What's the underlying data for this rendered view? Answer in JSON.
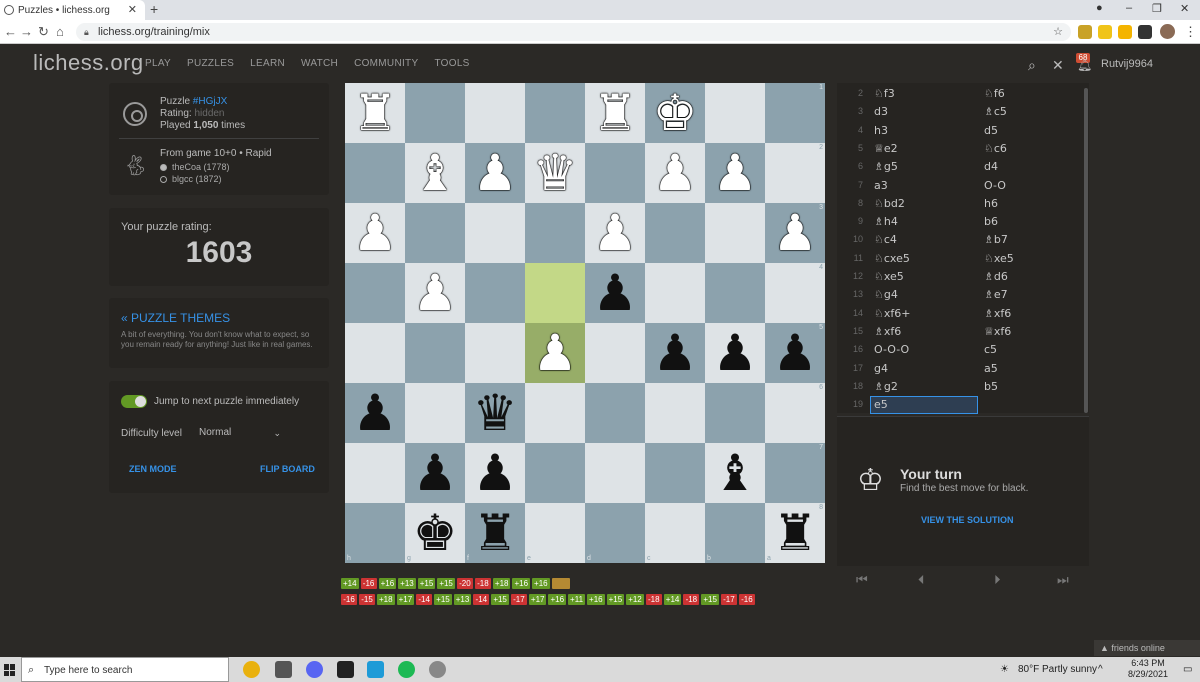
{
  "browser": {
    "tab_title": "Puzzles • lichess.org",
    "url": "lichess.org/training/mix"
  },
  "header": {
    "logo": "lichess.org",
    "nav": [
      "PLAY",
      "PUZZLES",
      "LEARN",
      "WATCH",
      "COMMUNITY",
      "TOOLS"
    ],
    "notification_count": "68",
    "username": "Rutvij9964"
  },
  "puzzle_info": {
    "puzzle_label": "Puzzle",
    "puzzle_id": "#HGjJX",
    "rating_label": "Rating:",
    "rating_value": "hidden",
    "played_prefix": "Played",
    "played_count": "1,050",
    "played_suffix": "times",
    "game_label": "From game 10+0 • Rapid",
    "white_player": "theCoa (1778)",
    "black_player": "blgcc (1872)"
  },
  "user_rating": {
    "label": "Your puzzle rating:",
    "value": "1603"
  },
  "themes": {
    "title": "« PUZZLE THEMES",
    "description": "A bit of everything. You don't know what to expect, so you remain ready for anything! Just like in real games."
  },
  "settings": {
    "jump_label": "Jump to next puzzle immediately",
    "jump_enabled": true,
    "difficulty_label": "Difficulty level",
    "difficulty_value": "Normal",
    "zen_mode": "ZEN MODE",
    "flip_board": "FLIP BOARD"
  },
  "board": {
    "orientation": "black",
    "rows": [
      [
        "wR",
        "",
        "",
        "",
        "wR",
        "wK",
        "",
        ""
      ],
      [
        "",
        "wB",
        "wP",
        "wQ",
        "",
        "wP",
        "wP",
        ""
      ],
      [
        "wP",
        "",
        "",
        "",
        "wP",
        "",
        "",
        "wP"
      ],
      [
        "",
        "wP",
        "",
        "HL",
        "bP",
        "",
        "",
        ""
      ],
      [
        "",
        "",
        "",
        "wP*",
        "",
        "bP",
        "bP",
        "bP"
      ],
      [
        "bP",
        "",
        "bQ",
        "",
        "",
        "",
        "",
        ""
      ],
      [
        "",
        "bP",
        "bP",
        "",
        "",
        "",
        "bB",
        ""
      ],
      [
        "",
        "bK",
        "bR",
        "",
        "",
        "",
        "",
        "bR"
      ]
    ],
    "rank_labels": [
      "1",
      "2",
      "3",
      "4",
      "5",
      "6",
      "7",
      "8"
    ],
    "file_labels": [
      "h",
      "g",
      "f",
      "e",
      "d",
      "c",
      "b",
      "a"
    ]
  },
  "moves": [
    {
      "n": "2",
      "w": "♘f3",
      "b": "♘f6"
    },
    {
      "n": "3",
      "w": "d3",
      "b": "♗c5"
    },
    {
      "n": "4",
      "w": "h3",
      "b": "d5"
    },
    {
      "n": "5",
      "w": "♕e2",
      "b": "♘c6"
    },
    {
      "n": "6",
      "w": "♗g5",
      "b": "d4"
    },
    {
      "n": "7",
      "w": "a3",
      "b": "O-O"
    },
    {
      "n": "8",
      "w": "♘bd2",
      "b": "h6"
    },
    {
      "n": "9",
      "w": "♗h4",
      "b": "b6"
    },
    {
      "n": "10",
      "w": "♘c4",
      "b": "♗b7"
    },
    {
      "n": "11",
      "w": "♘cxe5",
      "b": "♘xe5"
    },
    {
      "n": "12",
      "w": "♘xe5",
      "b": "♗d6"
    },
    {
      "n": "13",
      "w": "♘g4",
      "b": "♗e7"
    },
    {
      "n": "14",
      "w": "♘xf6+",
      "b": "♗xf6"
    },
    {
      "n": "15",
      "w": "♗xf6",
      "b": "♕xf6"
    },
    {
      "n": "16",
      "w": "O-O-O",
      "b": "c5"
    },
    {
      "n": "17",
      "w": "g4",
      "b": "a5"
    },
    {
      "n": "18",
      "w": "♗g2",
      "b": "b5"
    },
    {
      "n": "19",
      "w": "e5",
      "b": ""
    }
  ],
  "turn": {
    "title": "Your turn",
    "subtitle": "Find the best move for black.",
    "solution": "VIEW THE SOLUTION"
  },
  "history": {
    "row1": [
      "+14",
      "-16",
      "+16",
      "+13",
      "+15",
      "+15",
      "-20",
      "-18",
      "+18",
      "+16",
      "+16",
      ""
    ],
    "row2": [
      "-16",
      "-15",
      "+18",
      "+17",
      "-14",
      "+15",
      "+13",
      "-14",
      "+15",
      "-17",
      "+17",
      "+16",
      "+11",
      "+16",
      "+15",
      "+12",
      "-18",
      "+14",
      "-18",
      "+15",
      "-17",
      "-16"
    ]
  },
  "friends": "▲ friends online",
  "taskbar": {
    "search_placeholder": "Type here to search",
    "weather": "80°F  Partly sunny",
    "time": "6:43 PM",
    "date": "8/29/2021"
  }
}
